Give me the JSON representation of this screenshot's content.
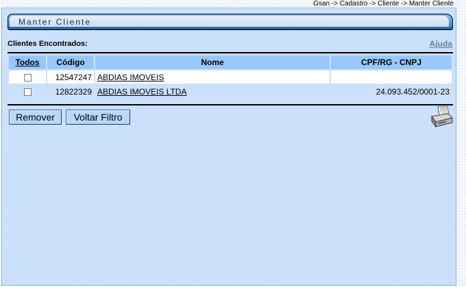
{
  "breadcrumb": "Gsan -> Cadastro -> Cliente -> Manter Cliente",
  "title": "Manter Cliente",
  "found_label": "Clientes Encontrados:",
  "help_link": "Ajuda",
  "table": {
    "headers": [
      "Todos",
      "Código",
      "Nome",
      "CPF/RG - CNPJ"
    ],
    "rows": [
      {
        "checked": false,
        "code": "12547247",
        "name": "ABDIAS IMOVEIS",
        "cpf": ""
      },
      {
        "checked": false,
        "code": "12822329",
        "name": "ABDIAS IMOVEIS LTDA",
        "cpf": "24.093.452/0001-23"
      }
    ]
  },
  "buttons": {
    "remove": "Remover",
    "back": "Voltar Filtro"
  },
  "icons": {
    "print": "printer-icon"
  }
}
